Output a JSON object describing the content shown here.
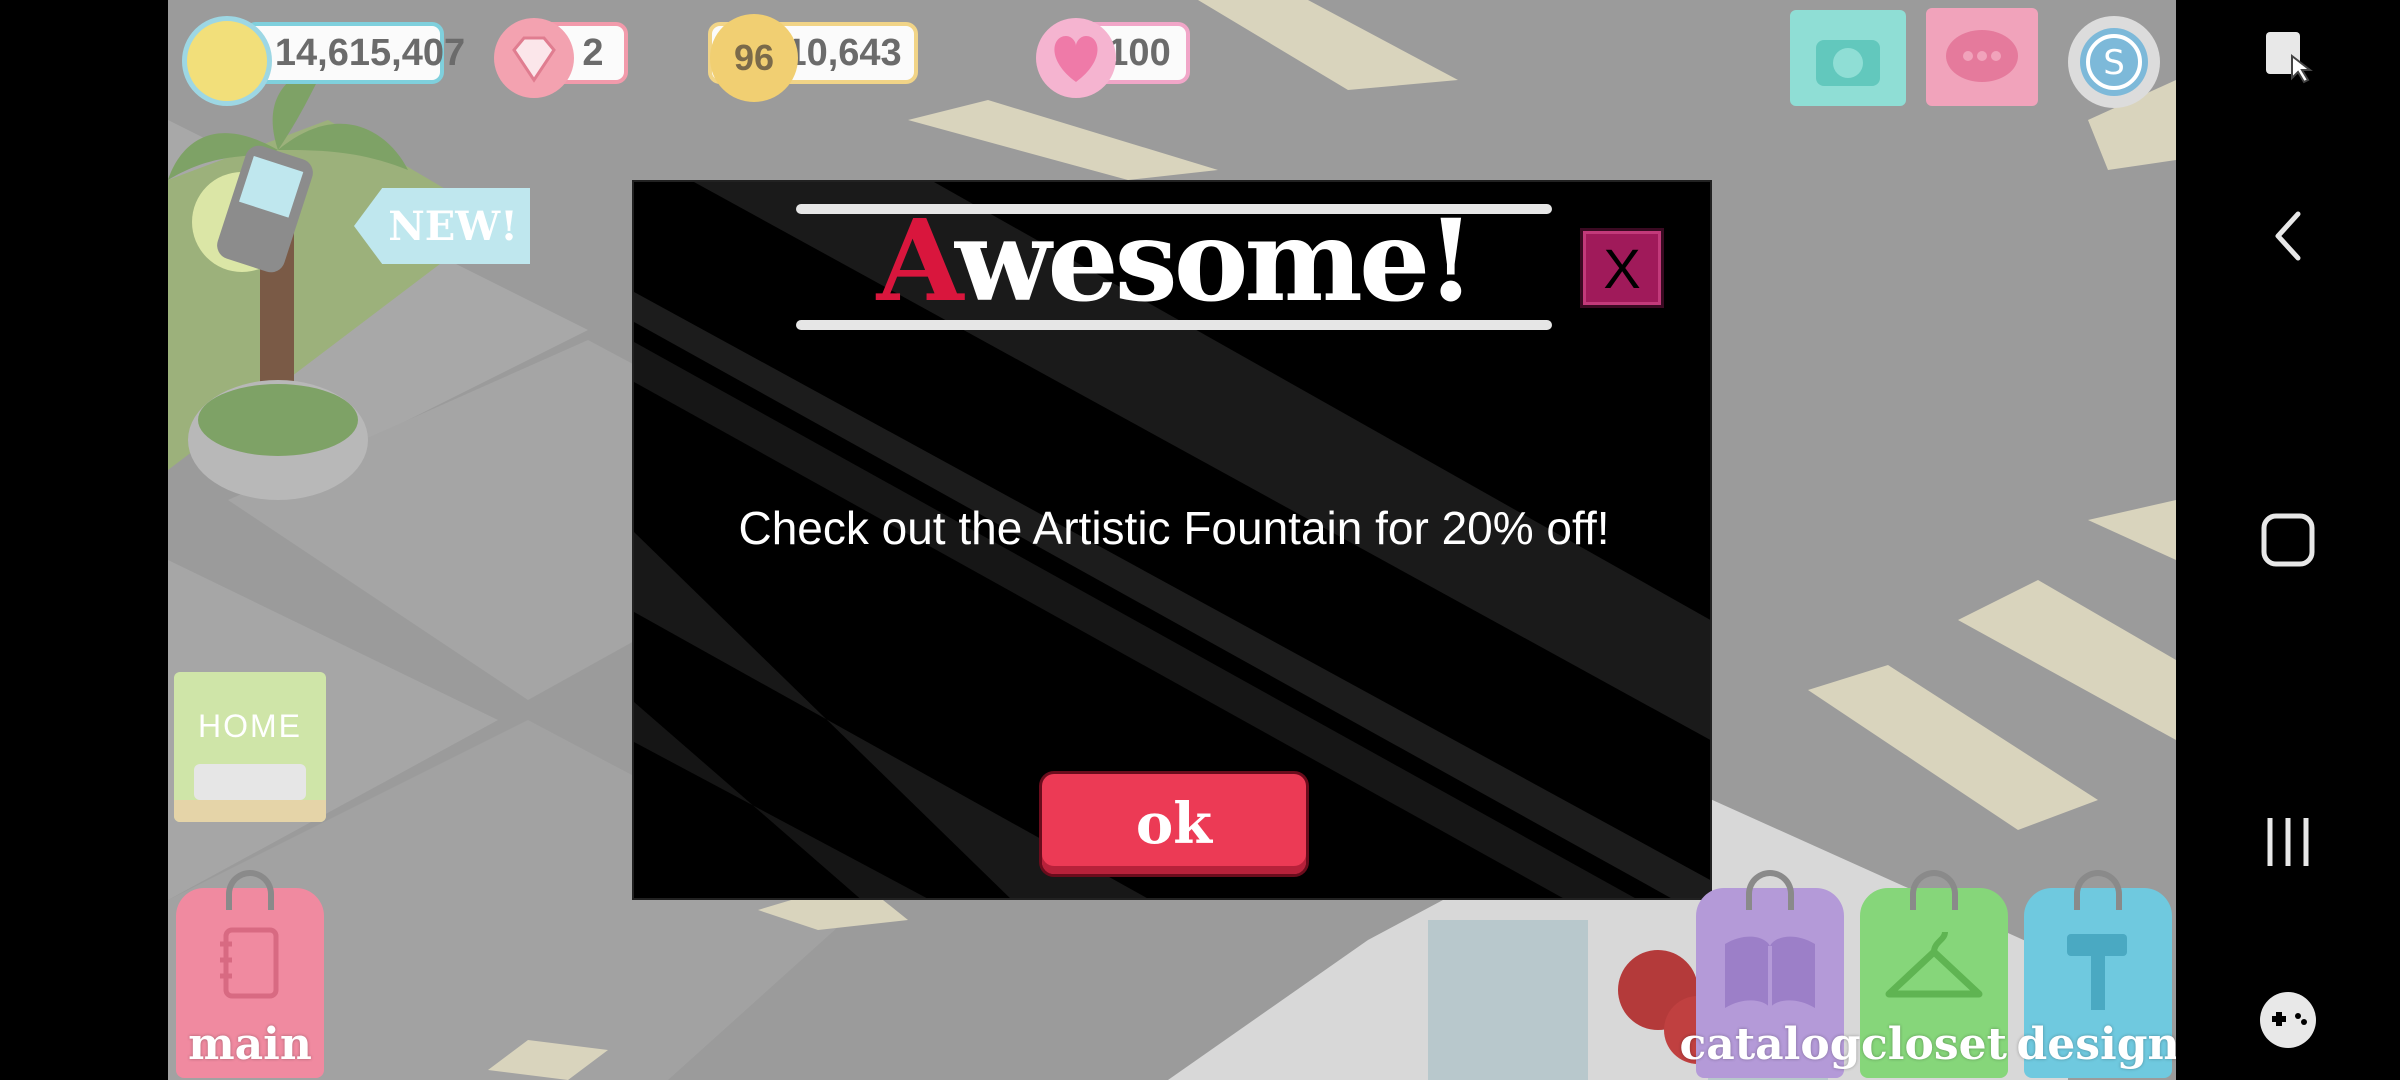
{
  "hud": {
    "coins": "14,615,407",
    "gems": "2",
    "level": "96",
    "xp": "910,643",
    "hearts": "100"
  },
  "home_label": "HOME",
  "new_badge": "NEW!",
  "dialog": {
    "title_first_letter": "A",
    "title_rest": "wesome!",
    "close_label": "X",
    "message": "Check out the Artistic Fountain for 20% off!",
    "ok_label": "ok"
  },
  "tabs": {
    "main": "main",
    "catalog": "catalog",
    "closet": "closet",
    "design": "design"
  },
  "colors": {
    "accent_red": "#d9163d",
    "ok_button": "#ec3a55",
    "close_button": "#a01a5a",
    "main_tag": "#f08aa0",
    "catalog_tag": "#b49ad8",
    "closet_tag": "#86d67a",
    "design_tag": "#6fc9df"
  },
  "icons": {
    "coin": "coin-icon",
    "gem": "diamond-icon",
    "star": "star-icon",
    "heart": "heart-icon",
    "camera": "camera-icon",
    "chat": "chat-icon",
    "social": "s-badge-icon",
    "phone": "phone-icon",
    "screenshot_toggle": "screen-pin-icon",
    "back": "back-icon",
    "home": "home-icon",
    "recents": "recents-icon",
    "game_tools": "gamepad-icon"
  }
}
